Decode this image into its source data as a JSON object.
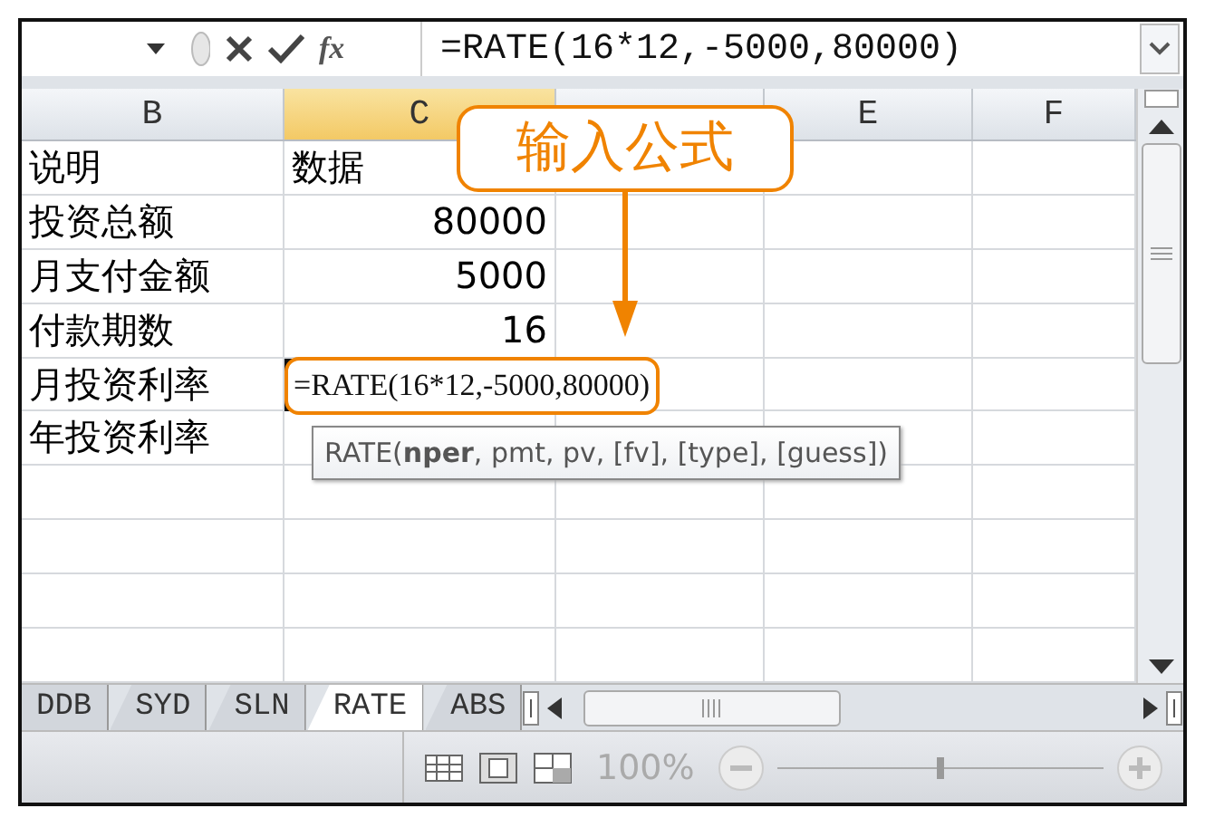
{
  "formula_bar": {
    "function_label": "fx",
    "formula": "=RATE(16*12,-5000,80000)"
  },
  "columns": [
    {
      "label": "B",
      "selected": false
    },
    {
      "label": "C",
      "selected": true
    },
    {
      "selected": false
    },
    {
      "label": "E",
      "selected": false
    },
    {
      "label": "F",
      "selected": false
    }
  ],
  "rows": [
    {
      "cells": [
        "说明",
        "数据"
      ],
      "kind": "labels"
    },
    {
      "cells": [
        "投资总额",
        "80000"
      ]
    },
    {
      "cells": [
        "月支付金额",
        "5000"
      ]
    },
    {
      "cells": [
        "付款期数",
        "16"
      ]
    },
    {
      "cells": [
        "月投资利率"
      ],
      "editing": "=RATE(16*12,-5000,80000)"
    },
    {
      "cells": [
        "年投资利率"
      ],
      "tooltip": "RATE(**nper**, pmt, pv, [fv], [type], [guess])"
    },
    {
      "cells": []
    },
    {
      "cells": []
    },
    {
      "cells": []
    },
    {
      "cells": []
    }
  ],
  "callout": "输入公式",
  "sheet_tabs": [
    {
      "label": "DDB",
      "selected": false
    },
    {
      "label": "SYD",
      "selected": false
    },
    {
      "label": "SLN",
      "selected": false
    },
    {
      "label": "RATE",
      "selected": true
    },
    {
      "label": "ABS",
      "selected": false
    }
  ],
  "status_bar": {
    "zoom": "100%",
    "zoom_slider": {
      "level": 0.5
    }
  }
}
